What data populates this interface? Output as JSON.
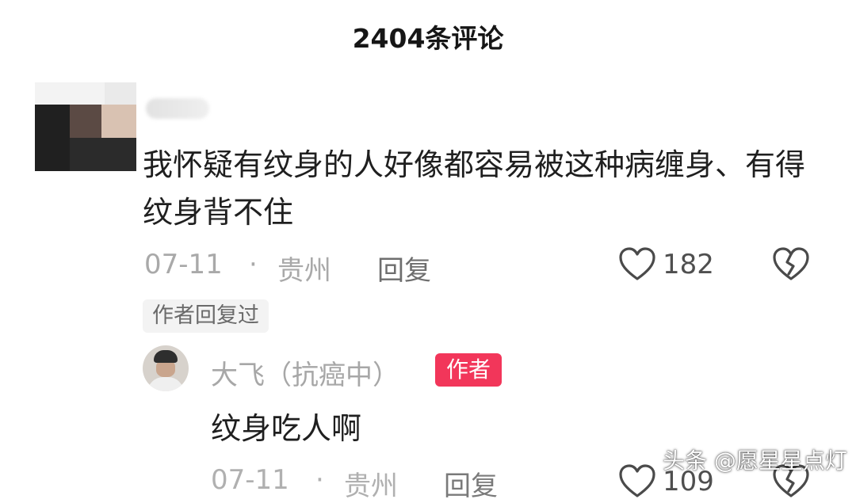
{
  "header": {
    "title": "2404条评论"
  },
  "comment": {
    "text": "我怀疑有纹身的人好像都容易被这种病缠身、有得纹身背不住",
    "date": "07-11",
    "separator": "·",
    "location": "贵州",
    "reply_label": "回复",
    "like_count": "182",
    "author_replied": "作者回复过"
  },
  "reply": {
    "username": "大飞（抗癌中）",
    "badge": "作者",
    "text": "纹身吃人啊",
    "date": "07-11",
    "separator": "·",
    "location": "贵州",
    "reply_label": "回复",
    "like_count": "109"
  },
  "watermark": {
    "text": "头条 @愿星星点灯"
  },
  "colors": {
    "badge": "#f2365a",
    "meta_gray": "#a9a9a9",
    "text": "#1f1f1f"
  },
  "icons": [
    "heart-icon",
    "broken-heart-icon"
  ]
}
